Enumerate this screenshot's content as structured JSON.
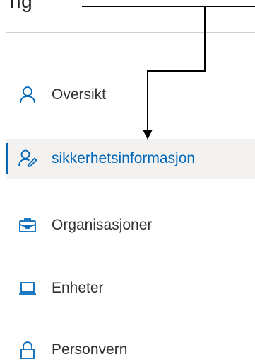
{
  "header": {
    "partial_text": "ng"
  },
  "colors": {
    "accent": "#0067b8",
    "active_background": "#f3f2f1",
    "text": "#323130"
  },
  "nav": {
    "items": [
      {
        "label": "Oversikt",
        "icon": "person-icon",
        "active": false
      },
      {
        "label": "sikkerhetsinformasjon",
        "icon": "security-info-icon",
        "active": true
      },
      {
        "label": "Organisasjoner",
        "icon": "briefcase-icon",
        "active": false
      },
      {
        "label": "Enheter",
        "icon": "laptop-icon",
        "active": false
      },
      {
        "label": "Personvern",
        "icon": "lock-icon",
        "active": false
      }
    ]
  }
}
